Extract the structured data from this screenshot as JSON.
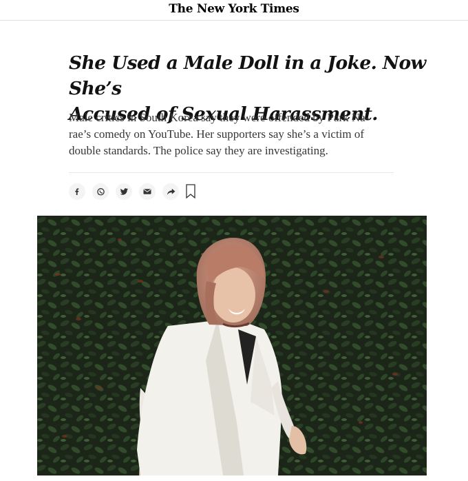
{
  "masthead": {
    "logo_text": "The New York Times"
  },
  "article": {
    "headline_line1": "She Used a Male Doll in a Joke. Now She’s",
    "headline_line2": "Accused of Sexual Harassment.",
    "summary_line1": "Male critics in South Korea say they were offended by Park Na-",
    "summary_line2": "rae’s comedy on YouTube. Her supporters say she’s a victim of",
    "summary_line3": "double standards. The police say they are investigating."
  },
  "share_bar": {
    "icons": [
      "facebook-icon",
      "whatsapp-icon",
      "twitter-icon",
      "email-icon",
      "share-icon",
      "bookmark-icon"
    ]
  },
  "photo": {
    "subject": "woman-in-white-blazer",
    "colors": {
      "foliage": "#243322",
      "hair": "#c58e78",
      "blazer": "#f4f2ee",
      "skin": "#e8c2a8"
    }
  }
}
